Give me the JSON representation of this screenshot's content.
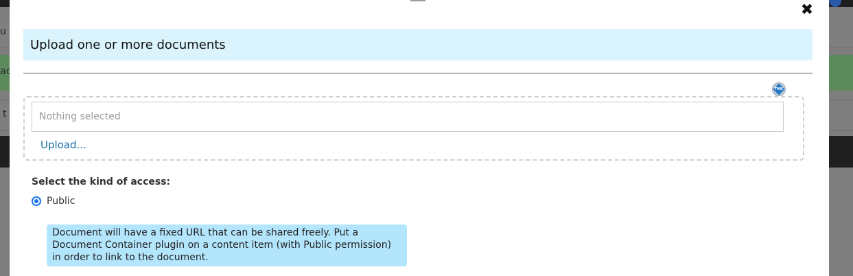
{
  "background": {
    "partial_text_1": "u",
    "partial_text_2": "ac",
    "partial_text_3": "t"
  },
  "modal": {
    "close_icon": "close-icon",
    "title": "Upload one or more documents",
    "file_input": {
      "placeholder": "Nothing selected"
    },
    "upload_link": "Upload...",
    "badge_icon": "tmk-badge-icon",
    "access_label": "Select the kind of access:",
    "access_options": [
      {
        "label": "Public",
        "selected": true
      }
    ],
    "info_text": "Document will have a fixed URL that can be shared freely. Put a Document Container plugin on a content item (with Public permission) in order to link to the document."
  },
  "colors": {
    "header_bg": "#daf3fc",
    "info_bg": "#b3e5fc",
    "link": "#1a6fa8",
    "radio": "#1a73e8"
  }
}
